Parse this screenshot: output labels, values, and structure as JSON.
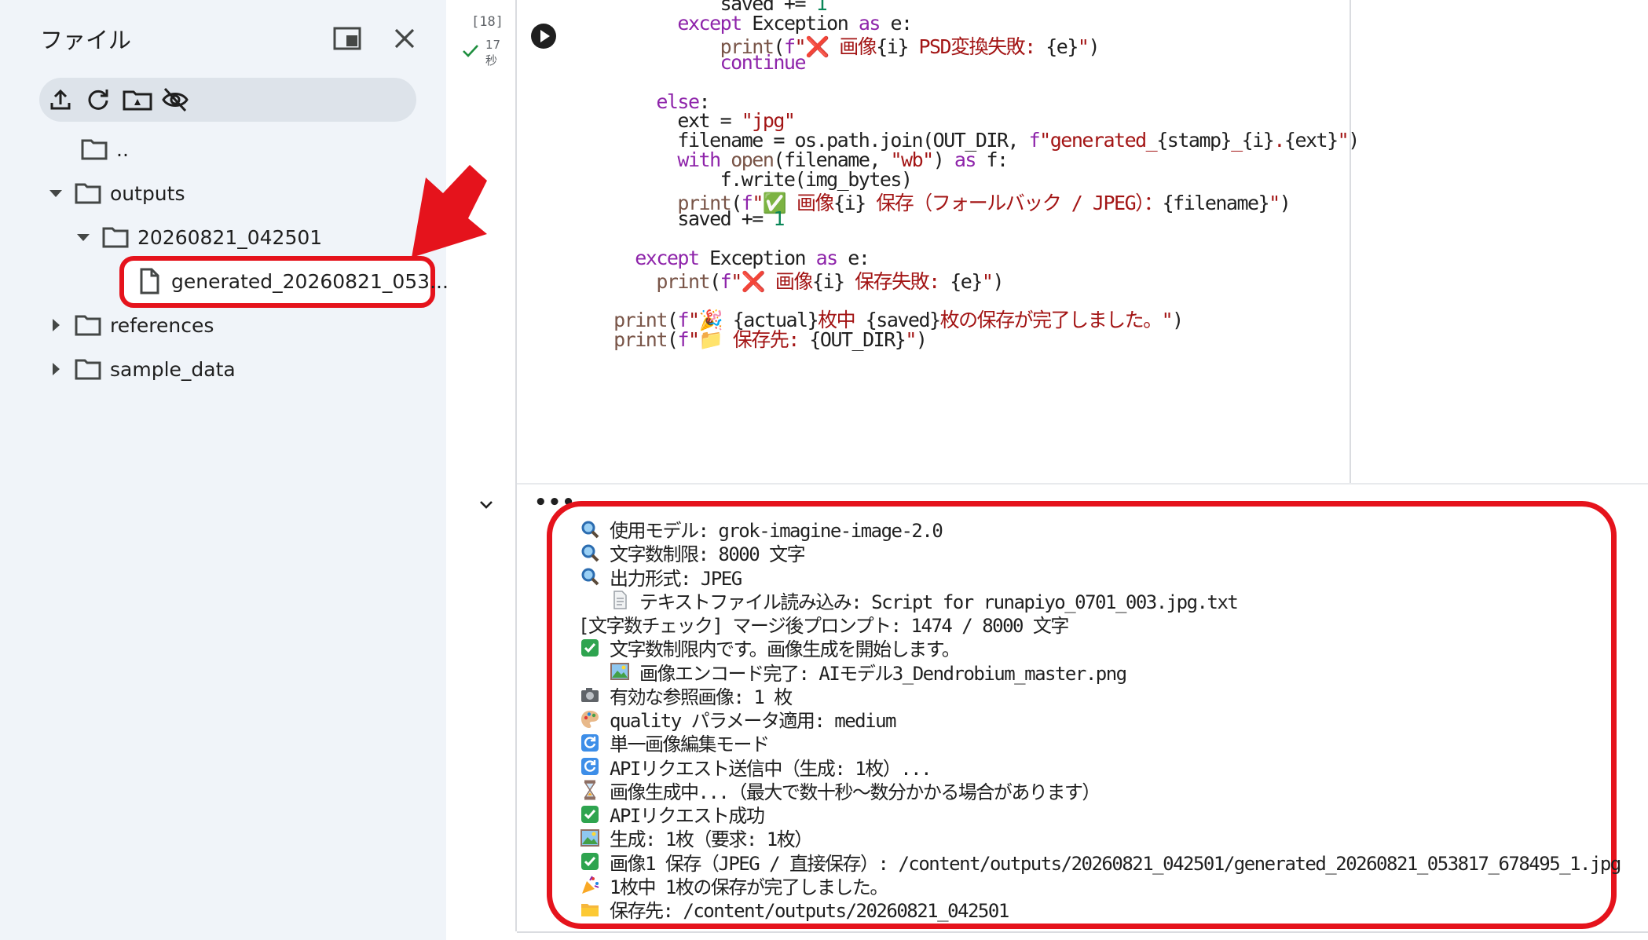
{
  "sidebar": {
    "title": "ファイル",
    "tree": [
      {
        "label": ".."
      },
      {
        "label": "outputs"
      },
      {
        "label": "20260821_042501"
      },
      {
        "label": "generated_20260821_053..."
      },
      {
        "label": "references"
      },
      {
        "label": "sample_data"
      }
    ]
  },
  "cell": {
    "exec_count": "[18]",
    "exec_time_value": "17",
    "exec_time_unit": "秒"
  },
  "code_lines": [
    "            saved += 1",
    "        except Exception as e:",
    "            print(f\"❌ 画像{i} PSD変換失敗: {e}\")",
    "            continue",
    "",
    "      else:",
    "        ext = \"jpg\"",
    "        filename = os.path.join(OUT_DIR, f\"generated_{stamp}_{i}.{ext}\")",
    "        with open(filename, \"wb\") as f:",
    "            f.write(img_bytes)",
    "        print(f\"✅ 画像{i} 保存（フォールバック / JPEG）：{filename}\")",
    "        saved += 1",
    "",
    "    except Exception as e:",
    "      print(f\"❌ 画像{i} 保存失敗: {e}\")",
    "",
    "  print(f\"🎉 {actual}枚中 {saved}枚の保存が完了しました。\")",
    "  print(f\"📁 保存先: {OUT_DIR}\")"
  ],
  "output_lines": [
    {
      "icon": "magnifier-icon",
      "text": "使用モデル: grok-imagine-image-2.0"
    },
    {
      "icon": "magnifier-icon",
      "text": "文字数制限: 8000 文字"
    },
    {
      "icon": "magnifier-icon",
      "text": "出力形式: JPEG"
    },
    {
      "icon": "document-icon",
      "text": "テキストファイル読み込み: Script for runapiyo_0701_003.jpg.txt"
    },
    {
      "icon": "",
      "text": "[文字数チェック] マージ後プロンプト: 1474 / 8000 文字"
    },
    {
      "icon": "check-icon",
      "text": "文字数制限内です。画像生成を開始します。"
    },
    {
      "icon": "picture-icon",
      "text": "画像エンコード完了: AIモデル3_Dendrobium_master.png"
    },
    {
      "icon": "camera-icon",
      "text": "有効な参照画像: 1 枚"
    },
    {
      "icon": "palette-icon",
      "text": "quality パラメータ適用: medium"
    },
    {
      "icon": "refresh-icon",
      "text": "単一画像編集モード"
    },
    {
      "icon": "refresh-icon",
      "text": "APIリクエスト送信中（生成: 1枚）..."
    },
    {
      "icon": "hourglass-icon",
      "text": "画像生成中...（最大で数十秒〜数分かかる場合があります）"
    },
    {
      "icon": "check-icon",
      "text": "APIリクエスト成功"
    },
    {
      "icon": "picture-icon",
      "text": "生成: 1枚（要求: 1枚）"
    },
    {
      "icon": "check-icon",
      "text": "画像1 保存（JPEG / 直接保存）: /content/outputs/20260821_042501/generated_20260821_053817_678495_1.jpg"
    },
    {
      "icon": "party-icon",
      "text": "1枚中 1枚の保存が完了しました。"
    },
    {
      "icon": "folder-icon",
      "text": "保存先: /content/outputs/20260821_042501"
    }
  ],
  "colors": {
    "highlight": "#e5131c",
    "keyword": "#8e24aa",
    "string": "#a31515",
    "number": "#098658"
  }
}
